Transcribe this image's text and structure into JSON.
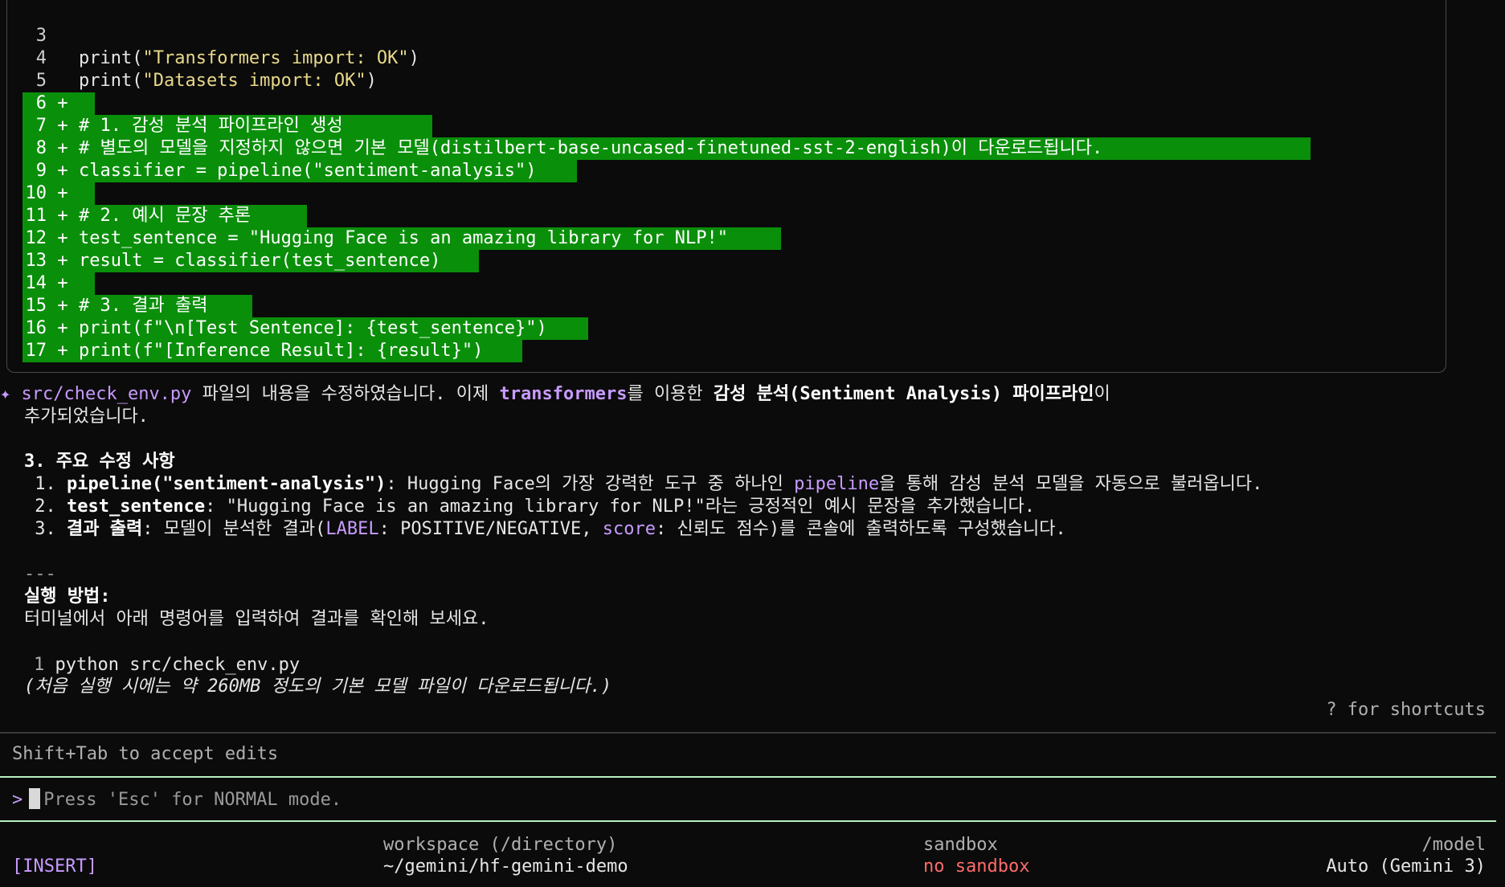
{
  "diff": {
    "lines": [
      {
        "num": "3",
        "sign": "",
        "code": "",
        "added": false
      },
      {
        "num": "4",
        "sign": "",
        "code_parts": [
          {
            "t": "print(",
            "c": ""
          },
          {
            "t": "\"Transformers import: OK\"",
            "c": "str"
          },
          {
            "t": ")",
            "c": ""
          }
        ],
        "added": false
      },
      {
        "num": "5",
        "sign": "",
        "code_parts": [
          {
            "t": "print(",
            "c": ""
          },
          {
            "t": "\"Datasets import: OK\"",
            "c": "str"
          },
          {
            "t": ")",
            "c": ""
          }
        ],
        "added": false
      },
      {
        "num": "6",
        "sign": "+",
        "code": "",
        "added": true
      },
      {
        "num": "7",
        "sign": "+",
        "code": "# 1. 감성 분석 파이프라인 생성",
        "added": true
      },
      {
        "num": "8",
        "sign": "+",
        "code": "# 별도의 모델을 지정하지 않으면 기본 모델(distilbert-base-uncased-finetuned-sst-2-english)이 다운로드됩니다.",
        "added": true
      },
      {
        "num": "9",
        "sign": "+",
        "code": "classifier = pipeline(\"sentiment-analysis\")",
        "added": true
      },
      {
        "num": "10",
        "sign": "+",
        "code": "",
        "added": true
      },
      {
        "num": "11",
        "sign": "+",
        "code": "# 2. 예시 문장 추론",
        "added": true
      },
      {
        "num": "12",
        "sign": "+",
        "code": "test_sentence = \"Hugging Face is an amazing library for NLP!\"",
        "added": true
      },
      {
        "num": "13",
        "sign": "+",
        "code": "result = classifier(test_sentence)",
        "added": true
      },
      {
        "num": "14",
        "sign": "+",
        "code": "",
        "added": true
      },
      {
        "num": "15",
        "sign": "+",
        "code": "# 3. 결과 출력",
        "added": true
      },
      {
        "num": "16",
        "sign": "+",
        "code": "print(f\"\\n[Test Sentence]: {test_sentence}\")",
        "added": true
      },
      {
        "num": "17",
        "sign": "+",
        "code": "print(f\"[Inference Result]: {result}\")",
        "added": true
      }
    ]
  },
  "message": {
    "star": "✦",
    "file": "src/check_env.py",
    "t1": " 파일의 내용을 수정하였습니다. 이제 ",
    "lib": "transformers",
    "t2": "를 이용한 ",
    "bold1": "감성 분석(Sentiment Analysis) 파이프라인",
    "t3": "이",
    "line2": "추가되었습니다."
  },
  "section": {
    "title": "3. 주요 수정 사항",
    "items": [
      {
        "n": " 1. ",
        "code": "pipeline(\"sentiment-analysis\")",
        "mid": ": Hugging Face의 가장 강력한 도구 중 하나인 ",
        "code2": "pipeline",
        "tail": "을 통해 감성 분석 모델을 자동으로 불러옵니다."
      },
      {
        "n": " 2. ",
        "code": "test_sentence",
        "mid": ": \"Hugging Face is an amazing library for NLP!\"라는 긍정적인 예시 문장을 추가했습니다.",
        "code2": "",
        "tail": ""
      },
      {
        "n": " 3. ",
        "bold": "결과 출력",
        "mid": ": 모델이 분석한 결과(",
        "code2": "LABEL",
        "mid2": ": POSITIVE/NEGATIVE, ",
        "code3": "score",
        "tail": ": 신뢰도 점수)를 콘솔에 출력하도록 구성했습니다."
      }
    ]
  },
  "separator": "---",
  "run": {
    "title": "실행 방법:",
    "desc": "터미널에서 아래 명령어를 입력하여 결과를 확인해 보세요.",
    "cmd_num": "1",
    "cmd": "python src/check_env.py",
    "note": "(처음 실행 시에는 약 260MB 정도의 기본 모델 파일이 다운로드됩니다.)"
  },
  "shortcuts_hint": "? for shortcuts",
  "accept_hint": "Shift+Tab to accept edits",
  "input": {
    "prompt": ">",
    "placeholder": "Press 'Esc' for NORMAL mode."
  },
  "footer": {
    "mode": "[INSERT]",
    "workspace_label": "workspace (/directory)",
    "workspace_value": "~/gemini/hf-gemini-demo",
    "sandbox_label": "sandbox",
    "sandbox_value": "no sandbox",
    "model_label": "/model",
    "model_value": "Auto (Gemini 3)"
  },
  "colors": {
    "added_bg": "#0a8f0a",
    "accent_purple": "#c89bff",
    "divider_green": "#b8f0c0",
    "sandbox_red": "#ff6b6b"
  }
}
